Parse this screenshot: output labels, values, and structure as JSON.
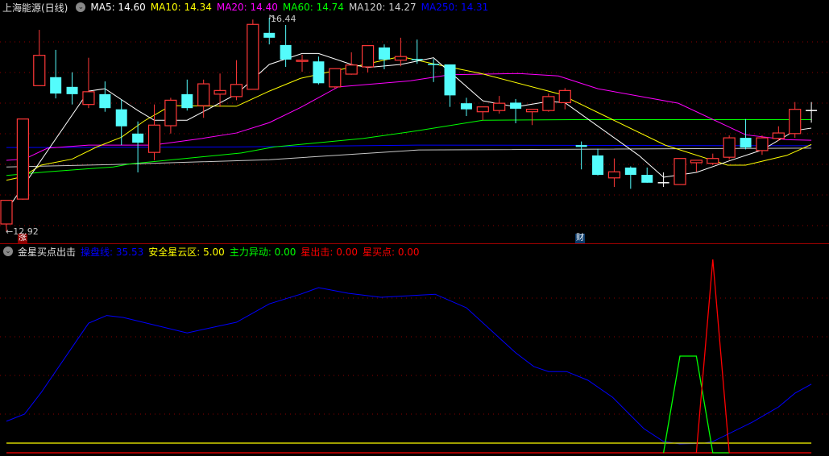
{
  "header": {
    "title": "上海能源(日线)",
    "ma": [
      {
        "label": "MA5: 14.60",
        "color": "#ffffff"
      },
      {
        "label": "MA10: 14.34",
        "color": "#ffff00"
      },
      {
        "label": "MA20: 14.40",
        "color": "#ff00ff"
      },
      {
        "label": "MA60: 14.74",
        "color": "#00ff00"
      },
      {
        "label": "MA120: 14.27",
        "color": "#d0d0d0"
      },
      {
        "label": "MA250: 14.31",
        "color": "#0000ff"
      }
    ]
  },
  "indicator": {
    "name": "金星买点出击",
    "items": [
      {
        "label": "操盘线: 35.53",
        "color": "#0000ff"
      },
      {
        "label": "安全星云区: 5.00",
        "color": "#ffff00"
      },
      {
        "label": "主力异动: 0.00",
        "color": "#00ff00"
      },
      {
        "label": "星出击: 0.00",
        "color": "#ff0000"
      },
      {
        "label": "星买点: 0.00",
        "color": "#ff0000"
      }
    ]
  },
  "annotations": {
    "high_label": "16.44",
    "low_label": "←12.92",
    "marker_zhang": "涨",
    "marker_cai": "财"
  },
  "chart_data": [
    {
      "type": "candlestick",
      "title": "上海能源(日线)",
      "ylim": [
        12.9,
        16.5
      ],
      "candles_ohlc": [
        [
          13.04,
          13.43,
          13.43,
          12.92
        ],
        [
          13.45,
          14.77,
          14.77,
          13.44
        ],
        [
          15.32,
          15.82,
          16.24,
          15.32
        ],
        [
          15.46,
          15.19,
          15.91,
          15.11
        ],
        [
          15.3,
          15.18,
          15.54,
          15.01
        ],
        [
          15.01,
          15.22,
          15.78,
          14.95
        ],
        [
          15.18,
          14.95,
          15.39,
          14.89
        ],
        [
          14.93,
          14.65,
          15.09,
          14.34
        ],
        [
          14.53,
          14.38,
          14.73,
          13.89
        ],
        [
          14.22,
          14.67,
          15.01,
          14.09
        ],
        [
          14.66,
          15.08,
          15.12,
          14.53
        ],
        [
          15.18,
          14.95,
          15.42,
          14.91
        ],
        [
          14.99,
          15.35,
          15.42,
          14.79
        ],
        [
          15.18,
          15.24,
          15.52,
          14.97
        ],
        [
          15.14,
          15.34,
          15.74,
          15.08
        ],
        [
          15.26,
          16.33,
          16.41,
          15.26
        ],
        [
          16.19,
          16.11,
          16.44,
          16.0
        ],
        [
          15.99,
          15.75,
          16.32,
          15.63
        ],
        [
          15.72,
          15.74,
          15.83,
          15.55
        ],
        [
          15.72,
          15.36,
          15.8,
          15.34
        ],
        [
          15.3,
          15.6,
          15.6,
          15.27
        ],
        [
          15.51,
          15.66,
          15.87,
          15.5
        ],
        [
          15.63,
          15.98,
          15.98,
          15.54
        ],
        [
          15.95,
          15.75,
          16.0,
          15.59
        ],
        [
          15.74,
          15.8,
          16.11,
          15.64
        ],
        [
          15.76,
          15.74,
          16.08,
          15.68
        ],
        [
          15.67,
          15.66,
          15.76,
          15.38
        ],
        [
          15.67,
          15.16,
          15.67,
          14.97
        ],
        [
          15.03,
          14.93,
          15.12,
          14.82
        ],
        [
          14.89,
          14.97,
          14.97,
          14.75
        ],
        [
          14.91,
          15.03,
          15.15,
          14.86
        ],
        [
          15.04,
          14.94,
          15.1,
          14.7
        ],
        [
          14.89,
          14.93,
          14.93,
          14.67
        ],
        [
          14.91,
          15.14,
          15.19,
          14.89
        ],
        [
          15.04,
          15.24,
          15.28,
          14.93
        ],
        [
          14.34,
          14.31,
          14.4,
          13.94
        ],
        [
          14.17,
          13.85,
          14.28,
          13.84
        ],
        [
          13.8,
          13.9,
          14.12,
          13.65
        ],
        [
          13.97,
          13.85,
          13.99,
          13.62
        ],
        [
          13.85,
          13.72,
          13.97,
          13.72
        ],
        [
          13.72,
          13.72,
          13.89,
          13.65
        ],
        [
          13.69,
          14.12,
          14.12,
          13.69
        ],
        [
          14.05,
          14.09,
          14.09,
          13.9
        ],
        [
          14.04,
          14.12,
          14.2,
          14.01
        ],
        [
          14.14,
          14.46,
          14.5,
          14.1
        ],
        [
          14.46,
          14.3,
          14.77,
          14.27
        ],
        [
          14.25,
          14.46,
          14.5,
          14.18
        ],
        [
          14.45,
          14.54,
          14.65,
          14.41
        ],
        [
          14.53,
          14.93,
          15.05,
          14.46
        ],
        [
          14.91,
          14.91,
          15.05,
          14.71
        ]
      ],
      "moving_averages": [
        {
          "name": "MA5",
          "color": "#ffffff",
          "points": [
            [
              1,
              13.26
            ],
            [
              6,
              15.23
            ],
            [
              7,
              15.27
            ],
            [
              9,
              14.91
            ],
            [
              10,
              14.75
            ],
            [
              12,
              14.75
            ],
            [
              15,
              15.18
            ],
            [
              17,
              15.67
            ],
            [
              19,
              15.85
            ],
            [
              20,
              15.85
            ],
            [
              22,
              15.67
            ],
            [
              23,
              15.62
            ],
            [
              25,
              15.67
            ],
            [
              27,
              15.78
            ],
            [
              30,
              15.07
            ],
            [
              32,
              14.97
            ],
            [
              34,
              15.06
            ],
            [
              35,
              15.04
            ],
            [
              39.5,
              14.17
            ],
            [
              41,
              13.81
            ],
            [
              43,
              13.89
            ],
            [
              45,
              14.08
            ],
            [
              47,
              14.26
            ],
            [
              49,
              14.58
            ],
            [
              50,
              14.62
            ]
          ]
        },
        {
          "name": "MA10",
          "color": "#ffff00",
          "points": [
            [
              1,
              13.76
            ],
            [
              2,
              13.82
            ],
            [
              3.1,
              14.01
            ],
            [
              5,
              14.11
            ],
            [
              6.5,
              14.31
            ],
            [
              8,
              14.47
            ],
            [
              9.4,
              14.74
            ],
            [
              11,
              14.99
            ],
            [
              15,
              14.98
            ],
            [
              17,
              15.23
            ],
            [
              18.9,
              15.44
            ],
            [
              20.7,
              15.55
            ],
            [
              22.3,
              15.64
            ],
            [
              25,
              15.8
            ],
            [
              27,
              15.68
            ],
            [
              29.9,
              15.52
            ],
            [
              34.7,
              15.18
            ],
            [
              37.9,
              14.76
            ],
            [
              41.1,
              14.34
            ],
            [
              41.9,
              14.27
            ],
            [
              44.9,
              14.01
            ],
            [
              46,
              14.01
            ],
            [
              48.5,
              14.17
            ],
            [
              50,
              14.35
            ]
          ]
        },
        {
          "name": "MA20",
          "color": "#ff00ff",
          "points": [
            [
              1,
              14.09
            ],
            [
              2.1,
              14.11
            ],
            [
              3.5,
              14.29
            ],
            [
              6,
              14.34
            ],
            [
              9.9,
              14.34
            ],
            [
              12.9,
              14.45
            ],
            [
              15,
              14.54
            ],
            [
              17,
              14.71
            ],
            [
              18.9,
              14.96
            ],
            [
              21.2,
              15.3
            ],
            [
              25.6,
              15.4
            ],
            [
              28,
              15.5
            ],
            [
              32.2,
              15.52
            ],
            [
              34.6,
              15.48
            ],
            [
              37,
              15.27
            ],
            [
              41.9,
              15.03
            ],
            [
              46,
              14.51
            ],
            [
              48.5,
              14.43
            ],
            [
              50,
              14.42
            ]
          ]
        },
        {
          "name": "MA60",
          "color": "#00ff00",
          "points": [
            [
              1,
              13.84
            ],
            [
              3.5,
              13.9
            ],
            [
              7.5,
              13.98
            ],
            [
              8.5,
              14.03
            ],
            [
              15.3,
              14.21
            ],
            [
              17.3,
              14.31
            ],
            [
              22.7,
              14.45
            ],
            [
              26.1,
              14.58
            ],
            [
              30,
              14.75
            ],
            [
              35.6,
              14.76
            ],
            [
              46.5,
              14.76
            ],
            [
              50,
              14.76
            ]
          ]
        },
        {
          "name": "MA120",
          "color": "#c8c8c8",
          "points": [
            [
              1,
              13.98
            ],
            [
              7.5,
              14.02
            ],
            [
              17,
              14.1
            ],
            [
              26.1,
              14.26
            ],
            [
              50,
              14.29
            ]
          ]
        },
        {
          "name": "MA250",
          "color": "#0000ff",
          "points": [
            [
              1,
              14.3
            ],
            [
              15,
              14.31
            ],
            [
              26,
              14.34
            ],
            [
              50,
              14.33
            ]
          ]
        }
      ]
    },
    {
      "type": "line",
      "title": "金星买点出击",
      "ylim": [
        0,
        100
      ],
      "gridlines": [
        20,
        40,
        60,
        80
      ],
      "series": [
        {
          "name": "操盘线",
          "color": "#0000ff",
          "points": [
            [
              1,
              16.3
            ],
            [
              2.1,
              20
            ],
            [
              3.1,
              31
            ],
            [
              6,
              67
            ],
            [
              7.1,
              71
            ],
            [
              8.1,
              70
            ],
            [
              12,
              62
            ],
            [
              15,
              67.5
            ],
            [
              17,
              77
            ],
            [
              18.9,
              82
            ],
            [
              20,
              85.4
            ],
            [
              21.8,
              82.5
            ],
            [
              23.8,
              80.4
            ],
            [
              27.1,
              82
            ],
            [
              29,
              75
            ],
            [
              32,
              51.7
            ],
            [
              33.1,
              44.6
            ],
            [
              34,
              42
            ],
            [
              35.1,
              42
            ],
            [
              36.4,
              37.5
            ],
            [
              37.9,
              28.7
            ],
            [
              39.8,
              12.5
            ],
            [
              41,
              5.8
            ],
            [
              42,
              4.6
            ],
            [
              43.5,
              5
            ],
            [
              44,
              5.8
            ],
            [
              46.4,
              15.8
            ],
            [
              48,
              23.7
            ],
            [
              49,
              30.8
            ],
            [
              50,
              35.5
            ]
          ]
        },
        {
          "name": "安全星云区",
          "color": "#ffff00",
          "points": [
            [
              1,
              5
            ],
            [
              50,
              5
            ]
          ]
        },
        {
          "name": "星出击",
          "color": "#ff0000",
          "points": [
            [
              1,
              0
            ],
            [
              50,
              0
            ]
          ]
        },
        {
          "name": "主力异动",
          "color": "#00ff00",
          "points": [
            [
              41,
              0
            ],
            [
              42,
              50
            ],
            [
              43,
              50
            ],
            [
              44,
              0
            ],
            [
              45,
              0
            ]
          ]
        },
        {
          "name": "星买点",
          "color": "#ff0000",
          "points": [
            [
              43,
              0
            ],
            [
              44,
              100
            ],
            [
              45,
              0
            ]
          ]
        }
      ]
    }
  ]
}
